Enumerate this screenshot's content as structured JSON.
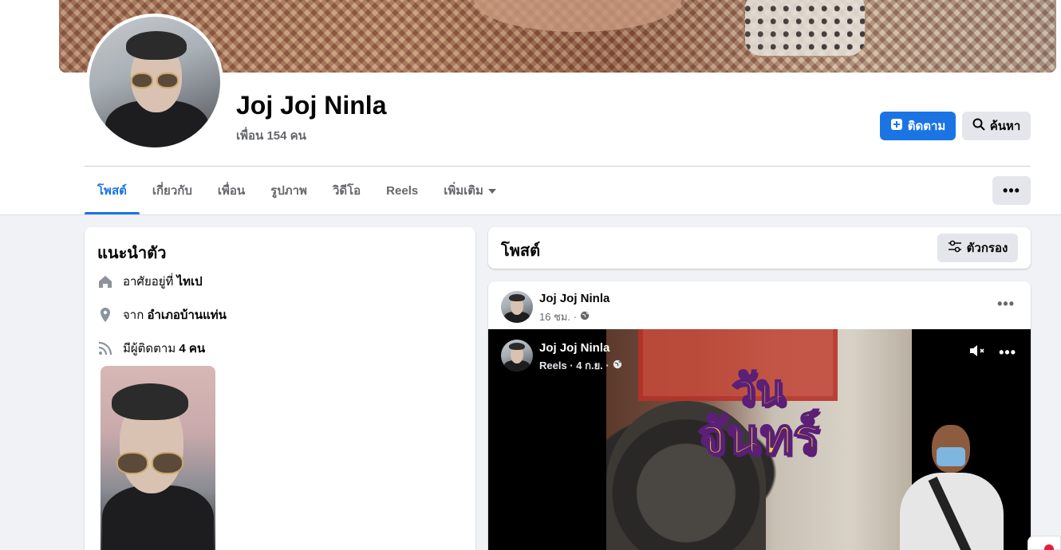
{
  "profile": {
    "name": "Joj Joj Ninla",
    "friends": "เพื่อน 154 คน"
  },
  "actions": {
    "follow_label": "ติดตาม",
    "search_label": "ค้นหา",
    "more_label": "•••"
  },
  "tabs": [
    {
      "label": "โพสต์",
      "active": true
    },
    {
      "label": "เกี่ยวกับ",
      "active": false
    },
    {
      "label": "เพื่อน",
      "active": false
    },
    {
      "label": "รูปภาพ",
      "active": false
    },
    {
      "label": "วิดีโอ",
      "active": false
    },
    {
      "label": "Reels",
      "active": false
    },
    {
      "label": "เพิ่มเติม",
      "active": false
    }
  ],
  "intro": {
    "title": "แนะนำตัว",
    "lives_prefix": "อาศัยอยู่ที่ ",
    "lives_value": "ไทเป",
    "from_prefix": "จาก ",
    "from_value": "อำเภอบ้านแท่น",
    "followers_prefix": "มีผู้ติดตาม ",
    "followers_value": "4 คน"
  },
  "posts": {
    "title": "โพสต์",
    "filter_label": "ตัวกรอง"
  },
  "post": {
    "author": "Joj Joj Ninla",
    "time": "16 ชม. ·",
    "menu": "•••",
    "video": {
      "author": "Joj Joj Ninla",
      "meta": "Reels · 4 ก.ย. ·",
      "overlay_line1": "วัน",
      "overlay_line2": "จันทร์",
      "menu": "•••"
    }
  },
  "colors": {
    "accent": "#1b74e4",
    "background": "#f0f2f5",
    "secondary_text": "#65676b"
  }
}
